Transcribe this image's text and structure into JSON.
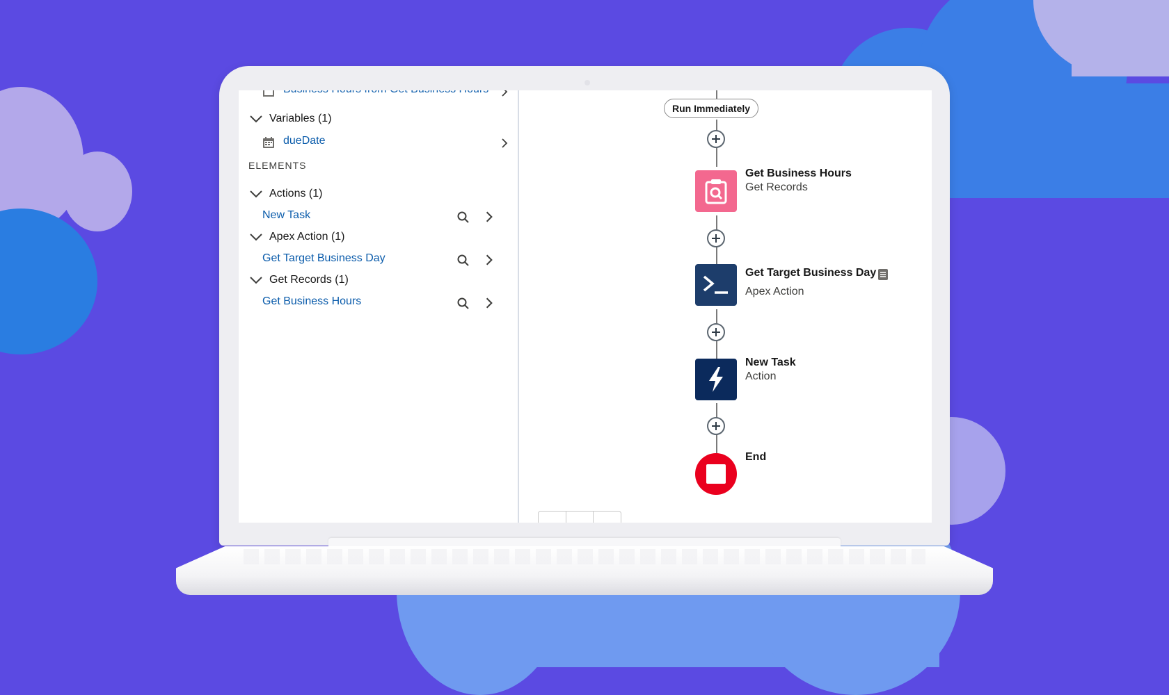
{
  "sidebar": {
    "resources": {
      "truncated_item": "Business Hours from Get Business Hours",
      "variables_header": "Variables (1)",
      "variable_item": "dueDate"
    },
    "elements_label": "ELEMENTS",
    "groups": [
      {
        "header": "Actions (1)",
        "item": "New Task"
      },
      {
        "header": "Apex Action (1)",
        "item": "Get Target Business Day"
      },
      {
        "header": "Get Records (1)",
        "item": "Get Business Hours"
      }
    ]
  },
  "canvas": {
    "start_pill": "Run Immediately",
    "nodes": [
      {
        "title": "Get Business Hours",
        "subtitle": "Get Records",
        "icon": "get-records-icon",
        "color": "#f3688f"
      },
      {
        "title": "Get Target Business Day",
        "subtitle": "Apex Action",
        "icon": "apex-terminal-icon",
        "color": "#1d3d6b"
      },
      {
        "title": "New Task",
        "subtitle": "Action",
        "icon": "lightning-icon",
        "color": "#0b2a5c"
      },
      {
        "title": "End",
        "icon": "stop-icon",
        "color": "#ea001e"
      }
    ]
  },
  "colors": {
    "background": "#5b4ae2",
    "link": "#0b5cab"
  }
}
